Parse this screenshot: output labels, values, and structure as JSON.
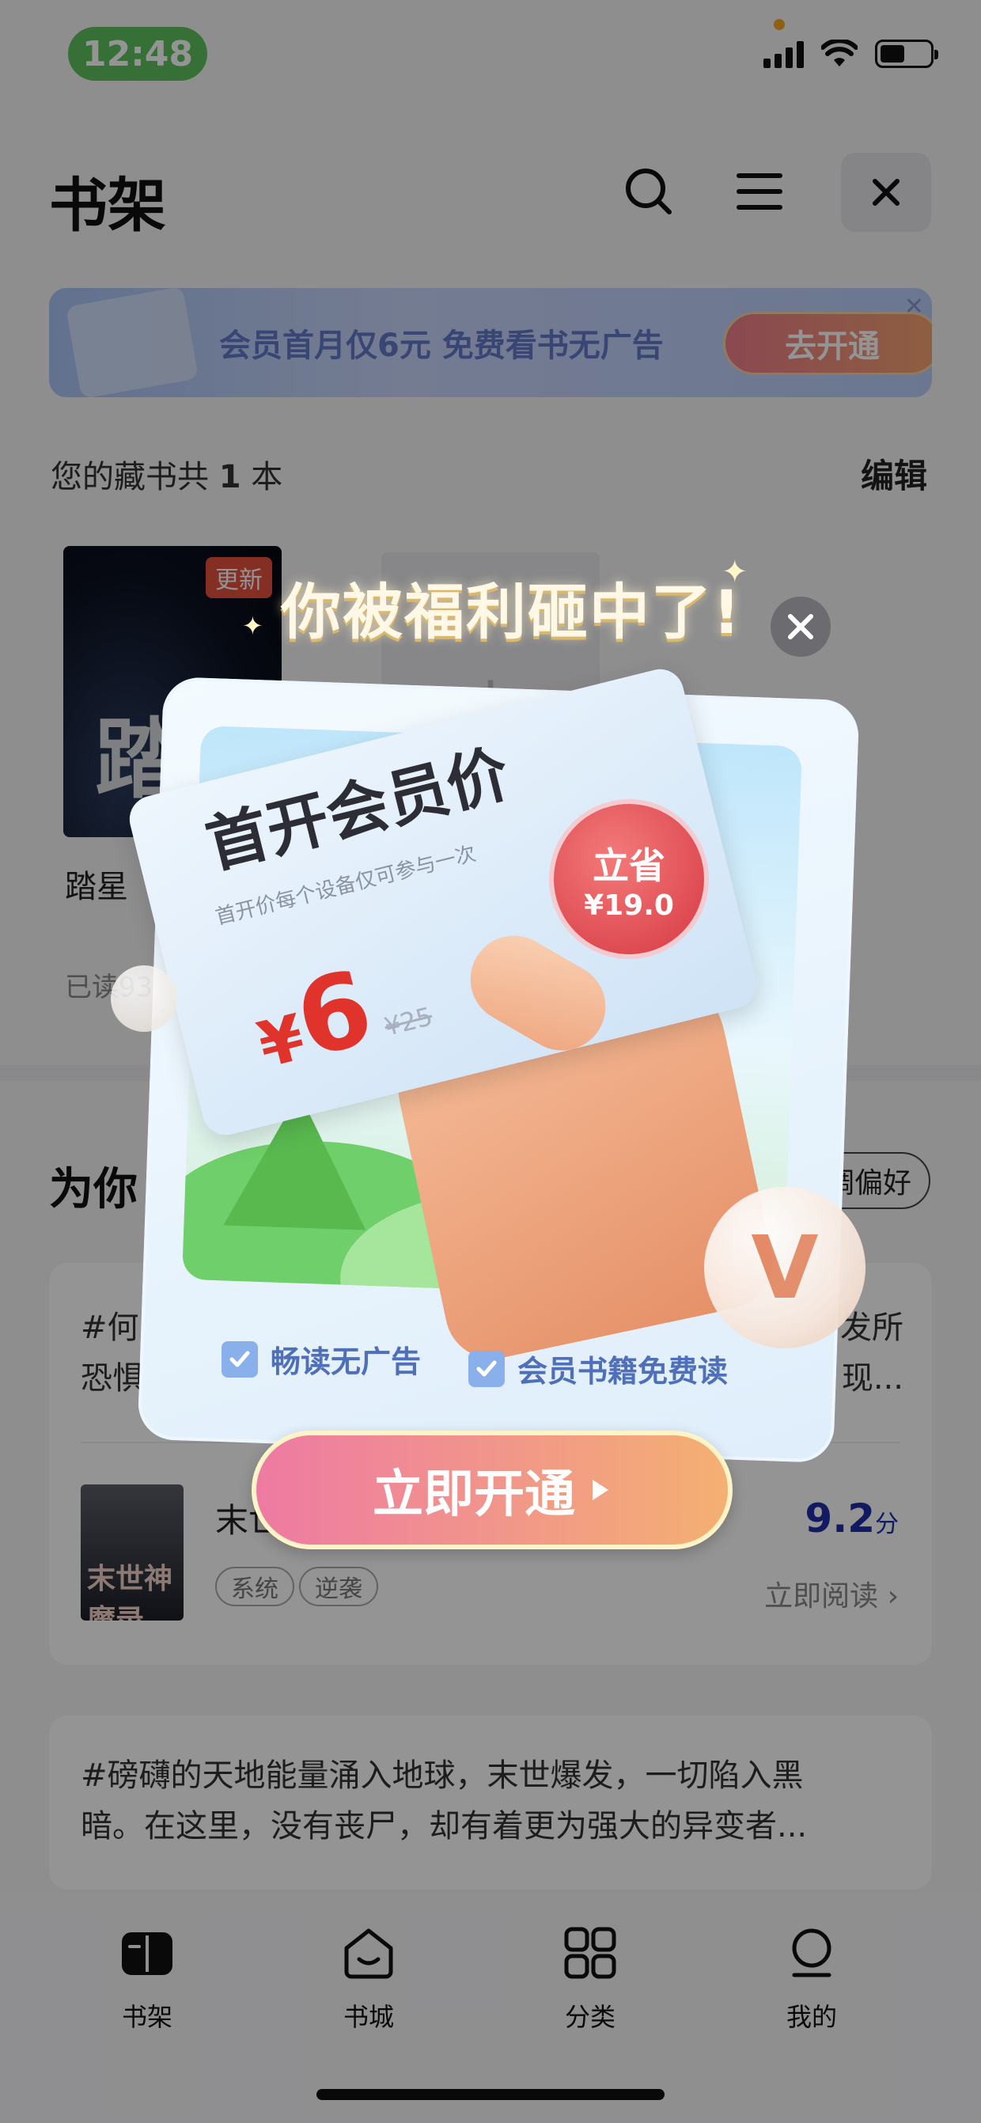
{
  "status": {
    "time": "12:48"
  },
  "header": {
    "title": "书架"
  },
  "vip_banner": {
    "text": "会员首月仅6元 免费看书无广告",
    "cta": "去开通"
  },
  "shelf": {
    "count_prefix": "您的藏书共",
    "count": "1",
    "count_suffix": "本",
    "edit": "编辑",
    "book": {
      "title": "踏星",
      "badge": "更新",
      "progress": "已读93"
    },
    "add_symbol": "+"
  },
  "recommend": {
    "title": "为你",
    "pref_button": "调偏好",
    "card1": {
      "desc_line1": "#何",
      "desc_line1_end": "发所",
      "desc_line2": "恐惧",
      "desc_line2_end": "现...",
      "book_name": "末世",
      "cover_text": "末世神魔录",
      "tags": [
        "系统",
        "逆袭"
      ],
      "score": "9.2",
      "score_unit": "分",
      "read": "立即阅读"
    },
    "card2": {
      "desc_line1": "#磅礴的天地能量涌入地球，末世爆发，一切陷入黑",
      "desc_line2": "暗。在这里，没有丧尸，却有着更为强大的异变者..."
    }
  },
  "tabs": [
    {
      "label": "书架",
      "icon": "book-icon"
    },
    {
      "label": "书城",
      "icon": "store-icon"
    },
    {
      "label": "分类",
      "icon": "grid-icon"
    },
    {
      "label": "我的",
      "icon": "profile-icon"
    }
  ],
  "popup": {
    "headline": "你被福利砸中了!",
    "card_title": "首开会员价",
    "card_subtitle": "首开价每个设备仅可参与一次",
    "currency": "¥",
    "price": "6",
    "old_price": "¥25",
    "save_label": "立省",
    "save_amount": "¥19.0",
    "perks": [
      "畅读无广告",
      "会员书籍免费读"
    ],
    "cta": "立即开通"
  },
  "colors": {
    "accent": "#1f2fa8",
    "price": "#e0332b",
    "status_pill": "#5fc15f"
  }
}
